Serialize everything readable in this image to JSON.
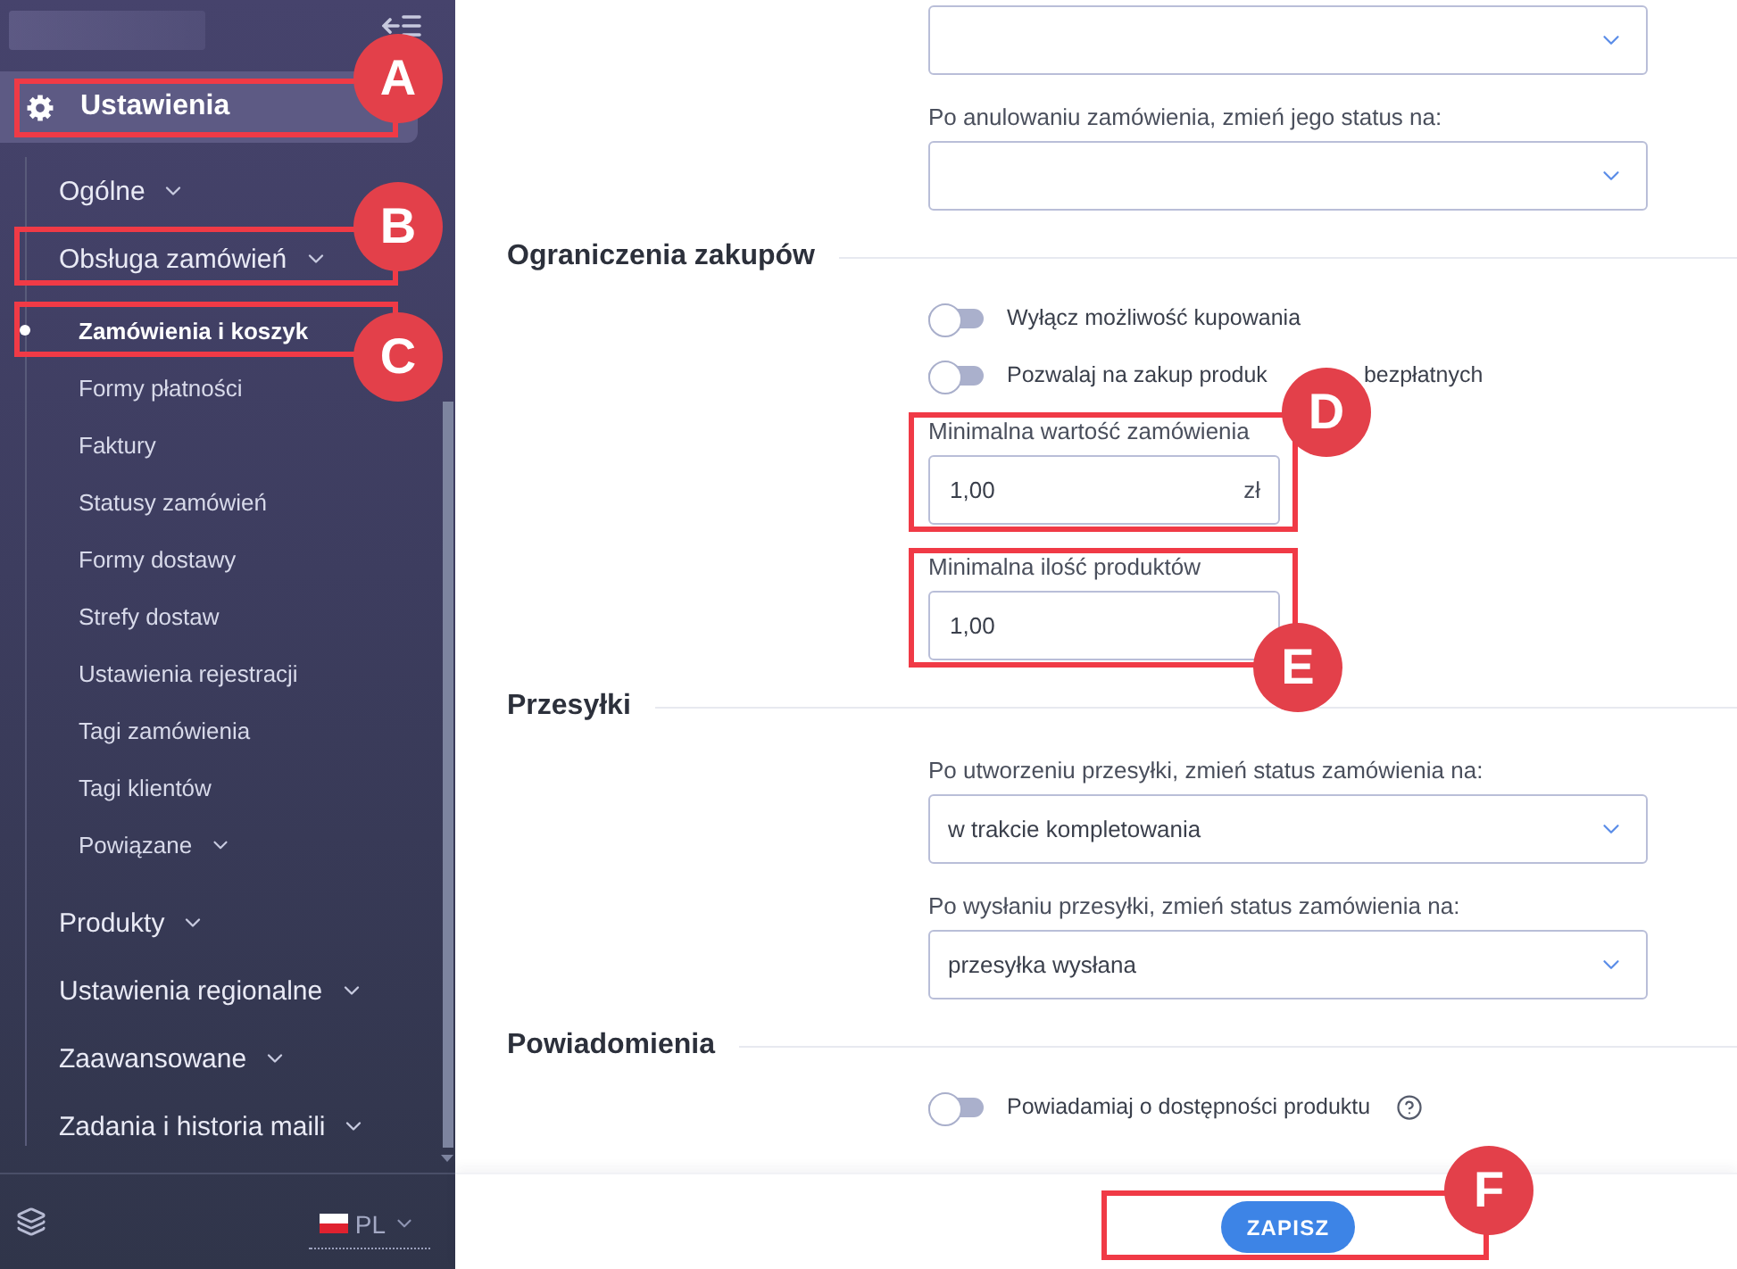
{
  "sidebar": {
    "section": {
      "label": "Ustawienia",
      "selected": true,
      "callout": "A"
    },
    "items": [
      {
        "label": "Ogólne",
        "kind": "group"
      },
      {
        "label": "Obsługa zamówień",
        "kind": "group",
        "callout": "B",
        "children": [
          {
            "label": "Zamówienia i koszyk",
            "kind": "link",
            "selected": true,
            "callout": "C"
          },
          {
            "label": "Formy płatności",
            "kind": "link",
            "selected": false
          },
          {
            "label": "Faktury",
            "kind": "link",
            "selected": false
          },
          {
            "label": "Statusy zamówień",
            "kind": "link",
            "selected": false
          },
          {
            "label": "Formy dostawy",
            "kind": "link",
            "selected": false
          },
          {
            "label": "Strefy dostaw",
            "kind": "link",
            "selected": false
          },
          {
            "label": "Ustawienia rejestracji",
            "kind": "link",
            "selected": false
          },
          {
            "label": "Tagi zamówienia",
            "kind": "link",
            "selected": false
          },
          {
            "label": "Tagi klientów",
            "kind": "link",
            "selected": false
          },
          {
            "label": "Powiązane",
            "kind": "group",
            "selected": false
          }
        ]
      },
      {
        "label": "Produkty",
        "kind": "group"
      },
      {
        "label": "Ustawienia regionalne",
        "kind": "group"
      },
      {
        "label": "Zaawansowane",
        "kind": "group"
      },
      {
        "label": "Zadania i historia maili",
        "kind": "group"
      }
    ],
    "language": "PL"
  },
  "form": {
    "sections": [
      {
        "fields": [
          {
            "kind": "select"
          },
          {
            "kind": "select",
            "label": "Po anulowaniu zamówienia, zmień jego status na:"
          }
        ]
      },
      {
        "title": "Ograniczenia zakupów",
        "fields": [
          {
            "kind": "toggle",
            "label": "Wyłącz możliwość kupowania",
            "on": false
          },
          {
            "kind": "toggle",
            "label_parts": [
              "Pozwalaj na zakup produk",
              "bezpłatnych"
            ],
            "on": false
          },
          {
            "kind": "input",
            "label": "Minimalna wartość zamówienia",
            "value": "1,00",
            "suffix": "zł",
            "callout": "D"
          },
          {
            "kind": "input",
            "label": "Minimalna ilość produktów",
            "value": "1,00",
            "callout": "E"
          }
        ]
      },
      {
        "title": "Przesyłki",
        "fields": [
          {
            "kind": "select",
            "label": "Po utworzeniu przesyłki, zmień status zamówienia na:",
            "value": "w trakcie kompletowania"
          },
          {
            "kind": "select",
            "label": "Po wysłaniu przesyłki, zmień status zamówienia na:",
            "value": "przesyłka wysłana"
          }
        ]
      },
      {
        "title": "Powiadomienia",
        "fields": [
          {
            "kind": "toggle",
            "label": "Powiadamiaj o dostępności produktu",
            "on": false,
            "help": true
          }
        ]
      }
    ]
  },
  "footer": {
    "save_button": {
      "label": "ZAPISZ",
      "callout": "F"
    }
  }
}
